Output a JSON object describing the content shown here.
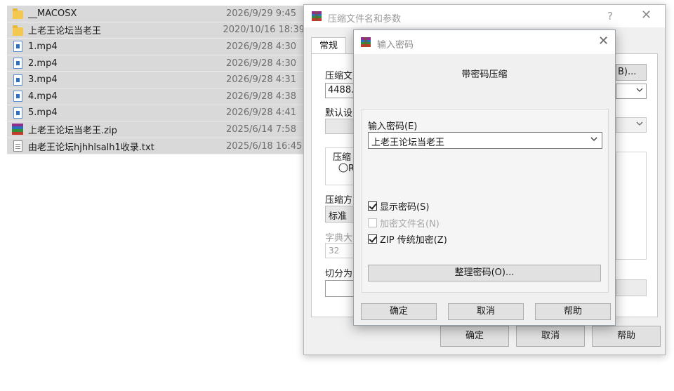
{
  "files": [
    {
      "name": "__MACOSX",
      "date": "2026/9/29 9:45",
      "icon": "folder-icon"
    },
    {
      "name": "上老王论坛当老王",
      "date": "2020/10/16 18:39",
      "icon": "folder-icon"
    },
    {
      "name": "1.mp4",
      "date": "2026/9/28 4:30",
      "icon": "video-file-icon"
    },
    {
      "name": "2.mp4",
      "date": "2026/9/28 4:30",
      "icon": "video-file-icon"
    },
    {
      "name": "3.mp4",
      "date": "2026/9/28 4:31",
      "icon": "video-file-icon"
    },
    {
      "name": "4.mp4",
      "date": "2026/9/28 4:38",
      "icon": "video-file-icon"
    },
    {
      "name": "5.mp4",
      "date": "2026/9/28 4:41",
      "icon": "video-file-icon"
    },
    {
      "name": "上老王论坛当老王.zip",
      "date": "2025/6/14 7:58",
      "icon": "rar-archive-icon"
    },
    {
      "name": "由老王论坛hjhhlsalh1收录.txt",
      "date": "2025/6/18 16:45",
      "icon": "text-file-icon"
    }
  ],
  "archive_dialog": {
    "title": "压缩文件名和参数",
    "help": "?",
    "close": "✕",
    "tab_general": "常规",
    "archive_name_label": "压缩文",
    "archive_name_value": "4488.z",
    "browse_button": "B)...",
    "default_settings_label": "默认设",
    "archive_format_label": "压缩",
    "archive_format_radio": "R",
    "method_label": "压缩方",
    "method_value": "标准",
    "dictionary_label": "字典大",
    "dictionary_value": "32",
    "split_label": "切分为",
    "ok": "确定",
    "cancel": "取消",
    "help_button": "帮助"
  },
  "password_dialog": {
    "title": "输入密码",
    "close": "✕",
    "heading": "带密码压缩",
    "password_label": "输入密码(E)",
    "password_value": "上老王论坛当老王",
    "show_password": {
      "label": "显示密码(S)",
      "checked": true
    },
    "encrypt_names": {
      "label": "加密文件名(N)",
      "checked": false
    },
    "zip_legacy": {
      "label": "ZIP 传统加密(Z)",
      "checked": true
    },
    "organize_button": "整理密码(O)...",
    "ok": "确定",
    "cancel": "取消",
    "help_button": "帮助"
  },
  "colors": {
    "selection": "#d9d9d9",
    "dialog_bg": "#f0f0f0",
    "button_bg": "#e1e1e1",
    "folder": "#f4c84f",
    "video_icon": "#2f6fc2"
  }
}
